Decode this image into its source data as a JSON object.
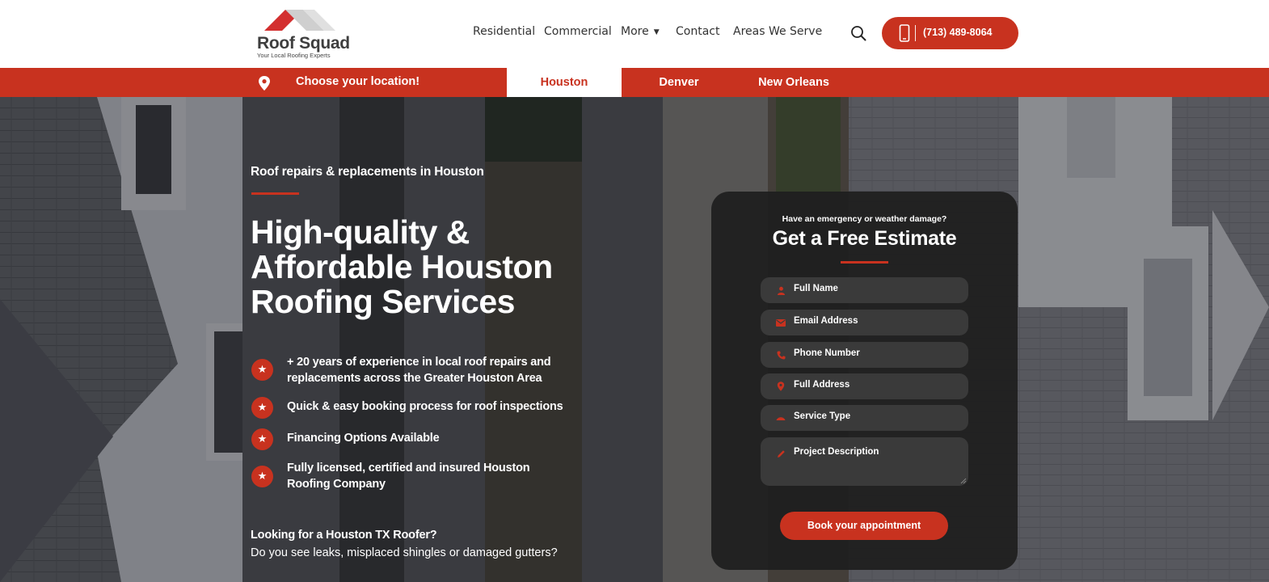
{
  "brand": {
    "name": "Roof Squad",
    "tagline": "Your Local Roofing Experts",
    "accent_color": "#c8321f"
  },
  "nav": {
    "items": [
      {
        "label": "Residential"
      },
      {
        "label": "Commercial"
      },
      {
        "label": "More"
      },
      {
        "label": "Contact"
      },
      {
        "label": "Areas We Serve"
      }
    ],
    "phone": "(713) 489-8064"
  },
  "locations": {
    "label": "Choose your location!",
    "cities": [
      {
        "label": "Houston",
        "selected": true
      },
      {
        "label": "Denver",
        "selected": false
      },
      {
        "label": "New Orleans",
        "selected": false
      }
    ]
  },
  "hero": {
    "eyebrow": "Roof repairs & replacements  in Houston",
    "headline": "High-quality & Affordable Houston Roofing Services",
    "features": [
      {
        "text": "+ 20 years of experience in local roof repairs and replacements across the Greater Houston Area"
      },
      {
        "text": "Quick & easy booking process for roof inspections"
      },
      {
        "text": "Financing Options Available"
      },
      {
        "text": "Fully licensed, certified and insured Houston Roofing Company"
      }
    ],
    "question": "Looking for a Houston TX Roofer?",
    "subquestion": "Do you see leaks, misplaced shingles or damaged gutters?"
  },
  "form": {
    "kicker": "Have an emergency or weather damage?",
    "title": "Get a Free Estimate",
    "fields": [
      {
        "placeholder": "Full Name",
        "icon": "person-icon"
      },
      {
        "placeholder": "Email Address",
        "icon": "envelope-icon"
      },
      {
        "placeholder": "Phone Number",
        "icon": "phone-icon"
      },
      {
        "placeholder": "Full Address",
        "icon": "map-pin-icon"
      },
      {
        "placeholder": "Service Type",
        "icon": "roof-icon"
      },
      {
        "placeholder": "Project Description",
        "icon": "pencil-icon"
      }
    ],
    "submit": "Book your appointment"
  }
}
